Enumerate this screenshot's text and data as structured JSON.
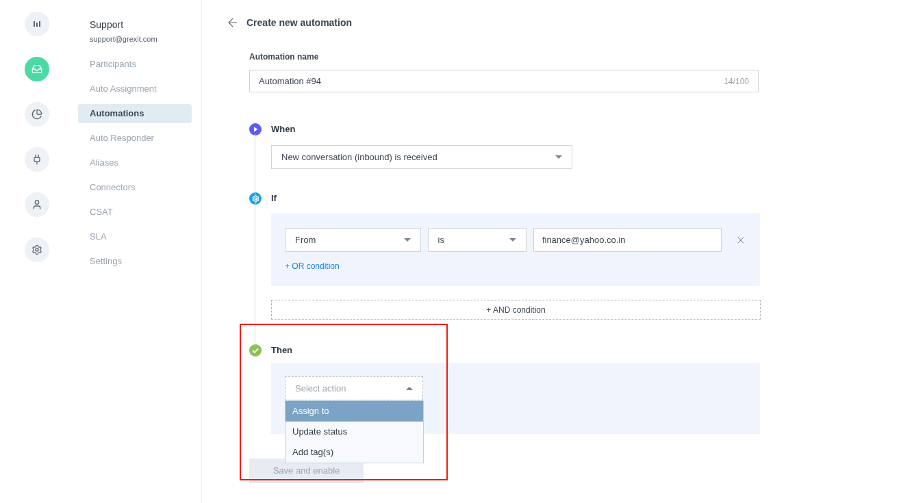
{
  "rail": [
    {
      "kind": "bars",
      "selected": false
    },
    {
      "kind": "inbox",
      "selected": true
    },
    {
      "kind": "pie",
      "selected": false
    },
    {
      "kind": "plug",
      "selected": false
    },
    {
      "kind": "user",
      "selected": false
    },
    {
      "kind": "gear",
      "selected": false
    }
  ],
  "account": {
    "name": "Support",
    "email": "support@grexit.com"
  },
  "nav": [
    {
      "label": "Participants",
      "selected": false
    },
    {
      "label": "Auto Assignment",
      "selected": false
    },
    {
      "label": "Automations",
      "selected": true
    },
    {
      "label": "Auto Responder",
      "selected": false
    },
    {
      "label": "Aliases",
      "selected": false
    },
    {
      "label": "Connectors",
      "selected": false
    },
    {
      "label": "CSAT",
      "selected": false
    },
    {
      "label": "SLA",
      "selected": false
    },
    {
      "label": "Settings",
      "selected": false
    }
  ],
  "header": {
    "title": "Create new automation"
  },
  "name_field": {
    "label": "Automation name",
    "value": "Automation #94",
    "counter": "14/100"
  },
  "when": {
    "title": "When",
    "select": "New conversation (inbound) is received"
  },
  "if": {
    "title": "If",
    "conditions": [
      {
        "field": "From",
        "operator": "is",
        "value": "finance@yahoo.co.in"
      }
    ],
    "or_link": "+ OR condition",
    "and_button": "+ AND condition"
  },
  "then": {
    "title": "Then",
    "select": {
      "placeholder": "Select action",
      "expanded": true
    },
    "options": [
      {
        "label": "Assign to",
        "selected": true
      },
      {
        "label": "Update status",
        "selected": false
      },
      {
        "label": "Add tag(s)",
        "selected": false
      }
    ]
  },
  "save_button": {
    "label": "Save and enable",
    "disabled": true
  }
}
